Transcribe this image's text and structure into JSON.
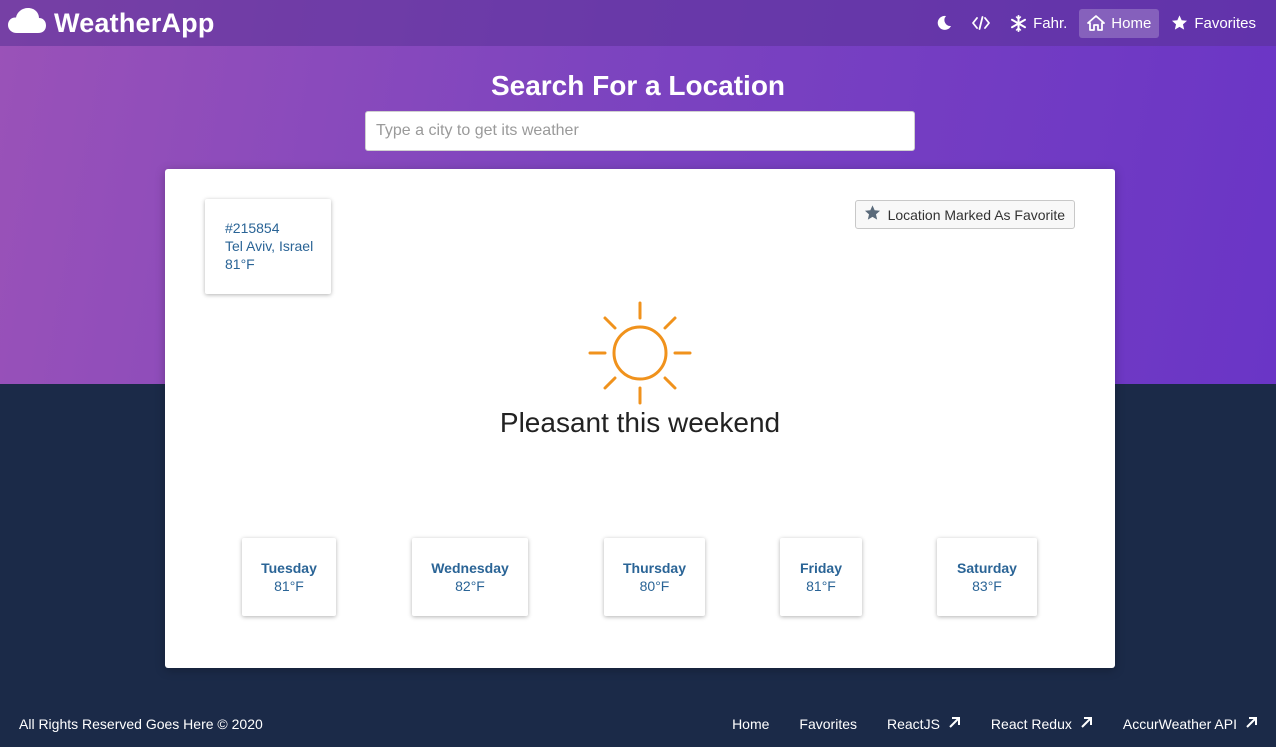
{
  "app": {
    "title": "WeatherApp"
  },
  "nav": {
    "theme_icon": "moon-icon",
    "code_icon": "code-icon",
    "units_label": "Fahr.",
    "home_label": "Home",
    "favorites_label": "Favorites"
  },
  "search": {
    "title": "Search For a Location",
    "placeholder": "Type a city to get its weather",
    "value": ""
  },
  "location": {
    "id": "#215854",
    "name": "Tel Aviv, Israel",
    "temp": "81°F"
  },
  "favorite_button": {
    "label": "Location Marked As Favorite"
  },
  "current": {
    "icon": "sun-icon",
    "headline": "Pleasant this weekend"
  },
  "forecast": [
    {
      "day": "Tuesday",
      "temp": "81°F"
    },
    {
      "day": "Wednesday",
      "temp": "82°F"
    },
    {
      "day": "Thursday",
      "temp": "80°F"
    },
    {
      "day": "Friday",
      "temp": "81°F"
    },
    {
      "day": "Saturday",
      "temp": "83°F"
    }
  ],
  "footer": {
    "copyright": "All Rights Reserved Goes Here © 2020",
    "links": [
      "Home",
      "Favorites",
      "ReactJS",
      "React Redux",
      "AccurWeather API"
    ]
  },
  "colors": {
    "hero_start": "#9a52b8",
    "hero_end": "#6a35c6",
    "dark_bg": "#1b2a48",
    "sun": "#f0921c",
    "link_blue": "#2a6496"
  }
}
